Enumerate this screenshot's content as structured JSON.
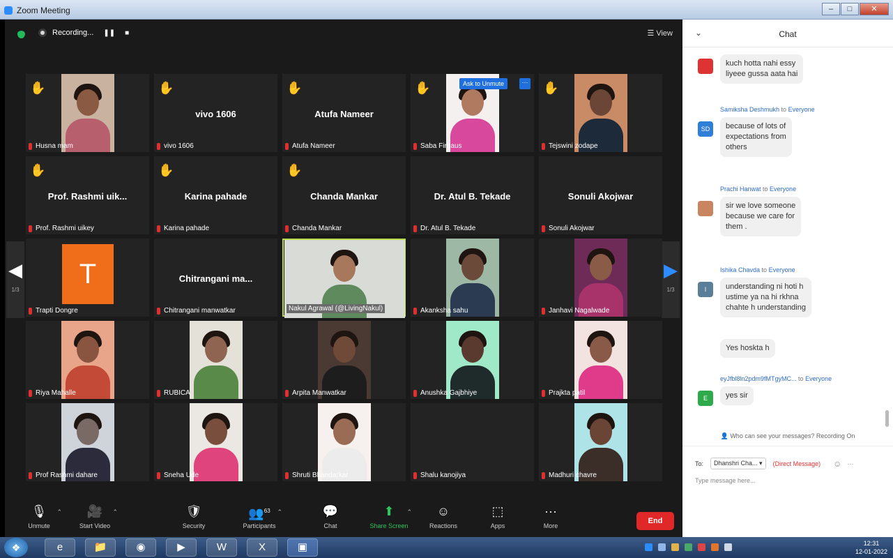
{
  "window": {
    "title": "Zoom Meeting",
    "minimize": "–",
    "maximize": "□",
    "close": "✕"
  },
  "topbar": {
    "recording_label": "Recording...",
    "pause_icon": "❚❚",
    "stop_icon": "■",
    "view_label": "☰ View"
  },
  "tiles": [
    {
      "name": "Husna mam",
      "hand": true,
      "video": true,
      "skin": "#8a5a42",
      "shirt": "#b85f6e",
      "bg": "#c9b3a0"
    },
    {
      "name": "vivo 1606",
      "hand": true,
      "video": false,
      "big": "vivo 1606"
    },
    {
      "name": "Atufa Nameer",
      "hand": true,
      "video": false,
      "big": "Atufa Nameer"
    },
    {
      "name": "Saba Firdaus",
      "hand": true,
      "video": true,
      "skin": "#b07a60",
      "shirt": "#d8489c",
      "bg": "#f4f0f0",
      "ask": "Ask to Unmute",
      "more": "···"
    },
    {
      "name": "Tejswini zodape",
      "hand": true,
      "video": true,
      "skin": "#6b4535",
      "shirt": "#1d2a3a",
      "bg": "#c98a66"
    },
    {
      "name": "Prof. Rashmi uikey",
      "hand": true,
      "video": false,
      "big": "Prof. Rashmi uik..."
    },
    {
      "name": "Karina pahade",
      "hand": true,
      "video": false,
      "big": "Karina pahade"
    },
    {
      "name": "Chanda Mankar",
      "hand": true,
      "video": false,
      "big": "Chanda Mankar"
    },
    {
      "name": "Dr. Atul B. Tekade",
      "hand": false,
      "video": false,
      "big": "Dr. Atul B. Tekade"
    },
    {
      "name": "Sonuli Akojwar",
      "hand": false,
      "video": false,
      "big": "Sonuli Akojwar"
    },
    {
      "name": "Trapti Dongre",
      "hand": false,
      "video": false,
      "avatar": "T"
    },
    {
      "name": "Chitrangani manwatkar",
      "hand": false,
      "video": false,
      "big": "Chitrangani  ma..."
    },
    {
      "name": "Nakul Agrawal (@LivingNakul)",
      "hand": false,
      "video": true,
      "speaker": true,
      "skin": "#a7785c",
      "shirt": "#5f8a5e",
      "bg": "#d9dcd6",
      "wide": true
    },
    {
      "name": "Akanksha sahu",
      "hand": false,
      "video": true,
      "skin": "#6b4a3a",
      "shirt": "#2a3b52",
      "bg": "#9eb8a6"
    },
    {
      "name": "Janhavi Nagalwade",
      "hand": false,
      "video": true,
      "skin": "#8a5c48",
      "shirt": "#a8336b",
      "bg": "#6e2b58"
    },
    {
      "name": "Riya Mahalle",
      "hand": false,
      "video": true,
      "skin": "#8a5540",
      "shirt": "#c24a36",
      "bg": "#e9a58a"
    },
    {
      "name": "RUBICA",
      "hand": false,
      "video": true,
      "skin": "#8f6450",
      "shirt": "#5a8a4a",
      "bg": "#e4e1d9"
    },
    {
      "name": "Arpita Manwatkar",
      "hand": false,
      "video": true,
      "skin": "#6f4a38",
      "shirt": "#1d1d1d",
      "bg": "#4b3a33"
    },
    {
      "name": "Anushka Gajbhiye",
      "hand": false,
      "video": true,
      "skin": "#5a3a2e",
      "shirt": "#1f2a2a",
      "bg": "#9fe8c8"
    },
    {
      "name": "Prajkta patil",
      "hand": false,
      "video": true,
      "skin": "#8a5a48",
      "shirt": "#e03b8b",
      "bg": "#f2e2e0"
    },
    {
      "name": "Prof Rashmi dahare",
      "hand": false,
      "video": true,
      "skin": "#7a6a66",
      "shirt": "#2b2b3b",
      "bg": "#cfd3da"
    },
    {
      "name": "Sneha Ude",
      "hand": false,
      "video": true,
      "skin": "#7a4e3c",
      "shirt": "#e0447c",
      "bg": "#ebe7e3"
    },
    {
      "name": "Shruti Bhandarkar",
      "hand": false,
      "video": true,
      "skin": "#9a6b55",
      "shirt": "#ececec",
      "bg": "#f6f1ef"
    },
    {
      "name": "Shalu kanojiya",
      "hand": false,
      "video": false
    },
    {
      "name": "Madhuri chavre",
      "hand": false,
      "video": true,
      "skin": "#6a4536",
      "shirt": "#3b2e28",
      "bg": "#aee4e8"
    }
  ],
  "pager": {
    "left_icon": "◀",
    "right_icon": "▶",
    "page_text": "1/3"
  },
  "toolbar": {
    "unmute": "Unmute",
    "start_video": "Start Video",
    "security": "Security",
    "participants": "Participants",
    "participants_count": "63",
    "chat": "Chat",
    "share_screen": "Share Screen",
    "reactions": "Reactions",
    "apps": "Apps",
    "more": "More",
    "end": "End"
  },
  "chat": {
    "title": "Chat",
    "collapse_icon": "⌄",
    "messages": [
      {
        "sender": "",
        "to": "",
        "initials": "",
        "avatar_color": "#d33",
        "text": [
          "kuch hotta nahi essy",
          "liyeee gussa aata hai"
        ]
      },
      {
        "sender": "Samiksha Deshmukh",
        "to": "to",
        "everyone": "Everyone",
        "initials": "SD",
        "avatar_color": "#2f7ed8",
        "text": [
          "because of lots of",
          "expectations from",
          "others"
        ]
      },
      {
        "sender": "Prachi Hanwat",
        "to": "to",
        "everyone": "Everyone",
        "initials": "",
        "avatar_color": "#c88560",
        "text": [
          "sir we love someone",
          "because we care for",
          "them ."
        ]
      },
      {
        "sender": "Ishika Chavda",
        "to": "to",
        "everyone": "Everyone",
        "initials": "I",
        "avatar_color": "#5b7f98",
        "text": [
          "understanding ni hoti h",
          "ustime ya na hi rkhna",
          "chahte h understanding"
        ]
      },
      {
        "sender": "",
        "to": "",
        "initials": "",
        "avatar_color": "",
        "text": [
          "Yes hoskta h"
        ]
      },
      {
        "sender": "eyJfbl8ln2pdm9fMTgyMC...",
        "to": "to",
        "everyone": "Everyone",
        "initials": "E",
        "avatar_color": "#2eaa4a",
        "text": [
          "yes sir"
        ]
      }
    ],
    "who_can_see": "Who can see your messages? Recording On",
    "to_label": "To:",
    "recipient": "Dhanshri Cha... ▾",
    "direct_message": "(Direct Message)",
    "emoji_icon": "☺",
    "more_icon": "···",
    "placeholder": "Type message here..."
  },
  "taskbar": {
    "start_icon": "❖",
    "clock_time": "12:31",
    "clock_date": "12-01-2022"
  }
}
